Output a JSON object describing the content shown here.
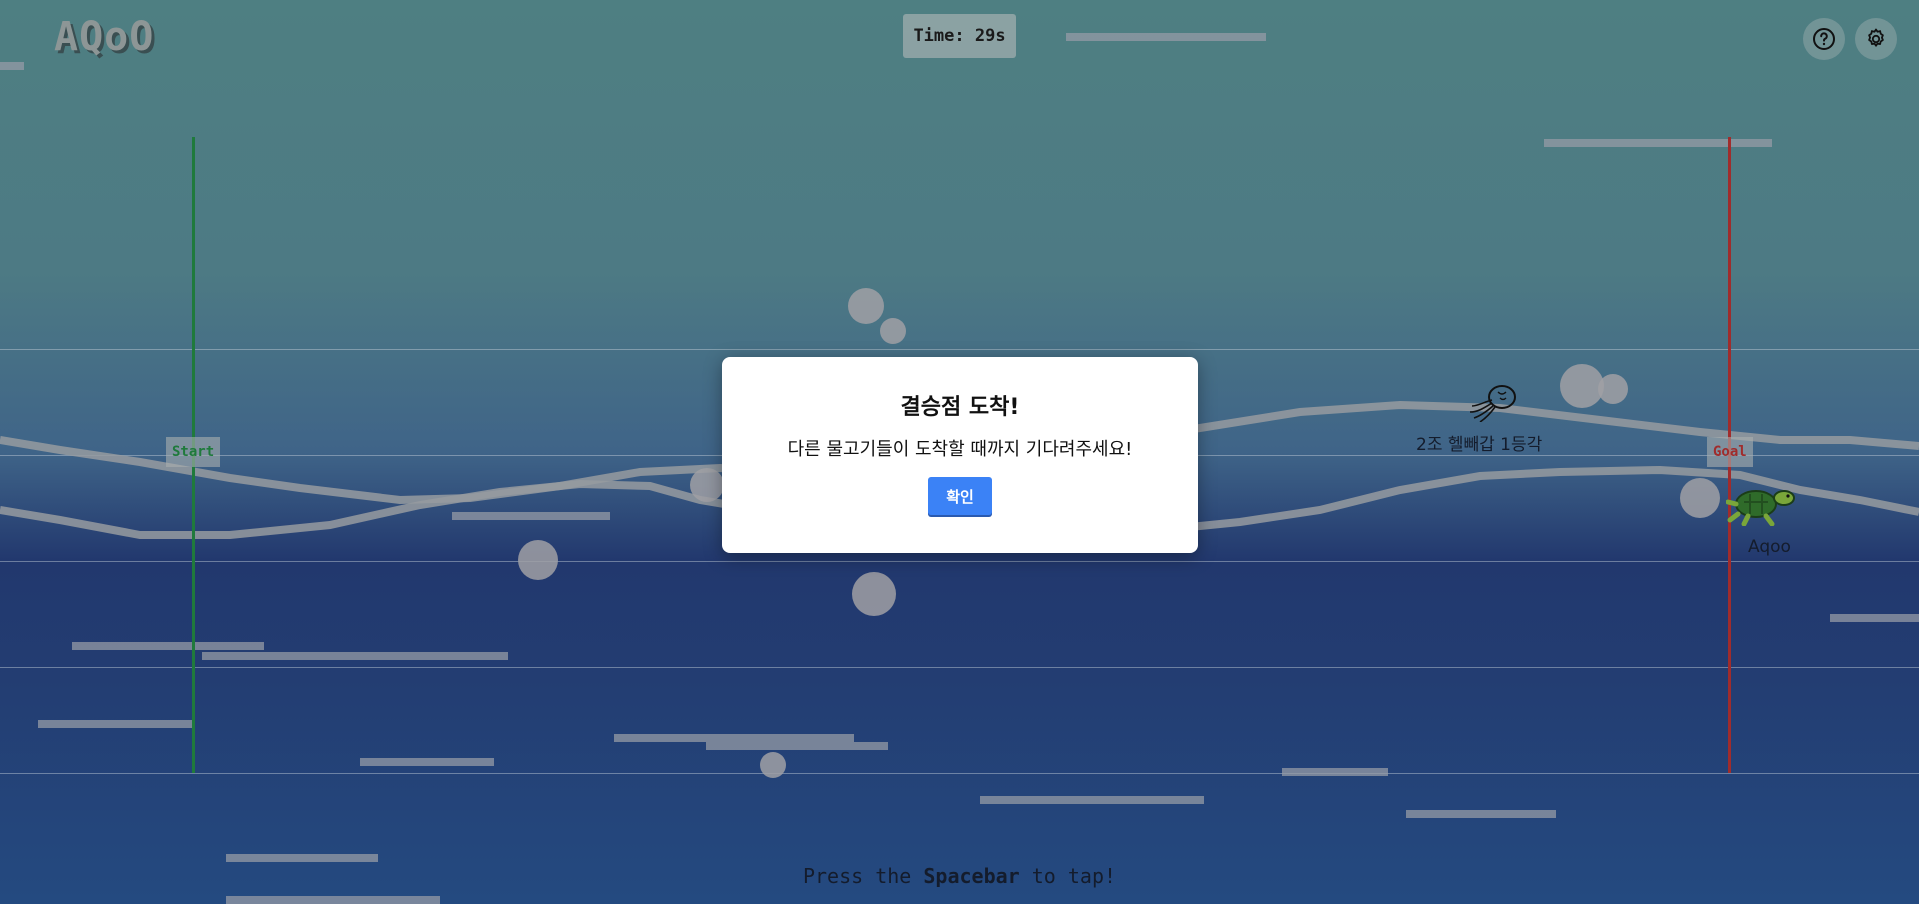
{
  "header": {
    "logo": "AQoO",
    "timer": "Time: 29s",
    "help_icon": "help-circle-icon",
    "settings_icon": "gear-icon"
  },
  "track": {
    "start_label": "Start",
    "goal_label": "Goal",
    "start_color": "#1f7a3c",
    "goal_color": "#a02c2c"
  },
  "racers": [
    {
      "name": "2조 헬빼갑 1등각",
      "icon": "jellyfish-icon"
    },
    {
      "name": "Aqoo",
      "icon": "turtle-icon"
    }
  ],
  "modal": {
    "title": "결승점 도착!",
    "message": "다른 물고기들이 도착할 때까지 기다려주세요!",
    "confirm_label": "확인",
    "button_color": "#3b82f6"
  },
  "hint": {
    "prefix": "Press the ",
    "key": "Spacebar",
    "suffix": " to tap!"
  }
}
